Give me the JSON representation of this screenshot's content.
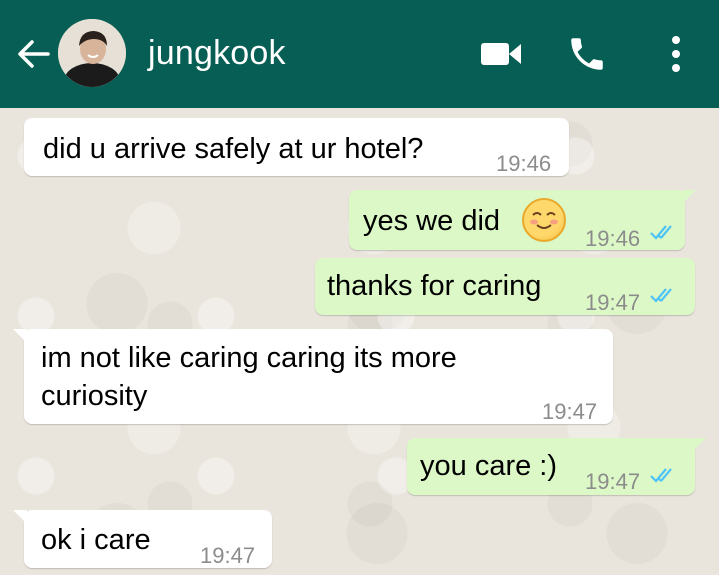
{
  "header": {
    "contact_name": "jungkook",
    "back_icon": "arrow-left-icon",
    "avatar": "contact-avatar",
    "video_icon": "video-call-icon",
    "call_icon": "phone-icon",
    "more_icon": "more-vertical-icon",
    "background_color": "#075e54"
  },
  "messages": [
    {
      "direction": "incoming",
      "text": "did u arrive safely at ur hotel?",
      "time": "19:46"
    },
    {
      "direction": "outgoing",
      "text": "yes we did",
      "emoji": "smiling-blush-emoji",
      "time": "19:46",
      "status": "read"
    },
    {
      "direction": "outgoing",
      "text": "thanks for caring",
      "time": "19:47",
      "status": "read"
    },
    {
      "direction": "incoming",
      "text_line1": "im not like caring caring its more",
      "text_line2": "curiosity",
      "time": "19:47"
    },
    {
      "direction": "outgoing",
      "text": "you care :)",
      "time": "19:47",
      "status": "read"
    },
    {
      "direction": "incoming",
      "text": "ok i care",
      "time": "19:47"
    }
  ],
  "colors": {
    "incoming_bubble": "#ffffff",
    "outgoing_bubble": "#dcf8c6",
    "read_ticks": "#4fc3f7",
    "wallpaper": "#e9e4dc"
  }
}
